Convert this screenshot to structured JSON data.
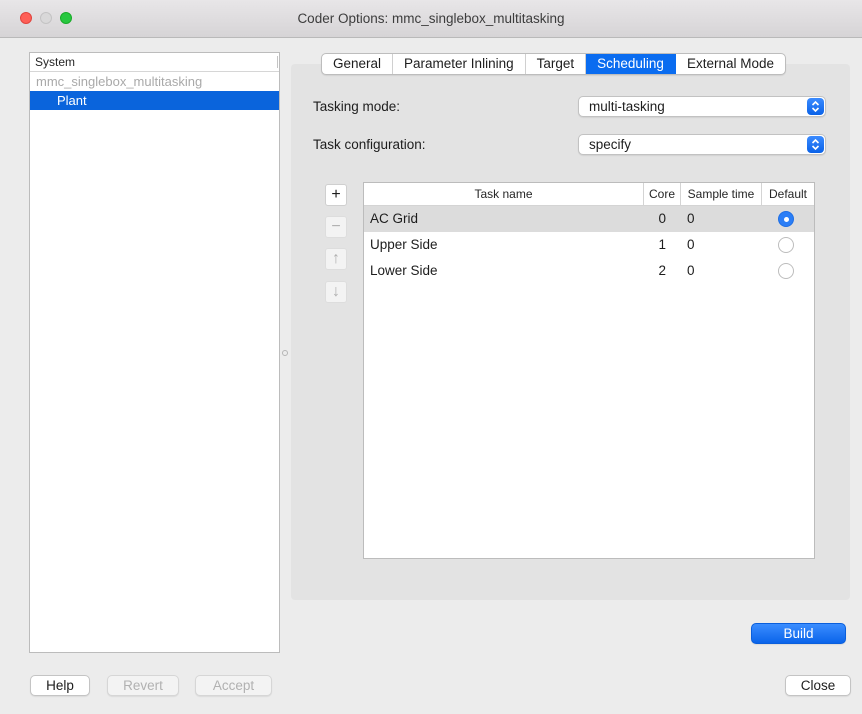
{
  "window": {
    "title": "Coder Options: mmc_singlebox_multitasking"
  },
  "tree": {
    "header": "System",
    "items": [
      {
        "label": "mmc_singlebox_multitasking"
      },
      {
        "label": "Plant"
      }
    ]
  },
  "tabs": [
    {
      "label": "General"
    },
    {
      "label": "Parameter Inlining"
    },
    {
      "label": "Target"
    },
    {
      "label": "Scheduling"
    },
    {
      "label": "External Mode"
    }
  ],
  "form": {
    "tasking_mode_label": "Tasking mode:",
    "tasking_mode_value": "multi-tasking",
    "task_config_label": "Task configuration:",
    "task_config_value": "specify"
  },
  "side_buttons": {
    "add": "+",
    "remove": "−",
    "up": "↑",
    "down": "↓"
  },
  "table": {
    "headers": {
      "name": "Task name",
      "core": "Core",
      "sample": "Sample time",
      "default": "Default"
    },
    "rows": [
      {
        "name": "AC Grid",
        "core": "0",
        "sample": "0"
      },
      {
        "name": "Upper Side",
        "core": "1",
        "sample": "0"
      },
      {
        "name": "Lower Side",
        "core": "2",
        "sample": "0"
      }
    ]
  },
  "buttons": {
    "build": "Build",
    "help": "Help",
    "revert": "Revert",
    "accept": "Accept",
    "close": "Close"
  },
  "colors": {
    "accent": "#0a64dc",
    "close_red": "#fe5f57",
    "zoom_green": "#28c840"
  }
}
